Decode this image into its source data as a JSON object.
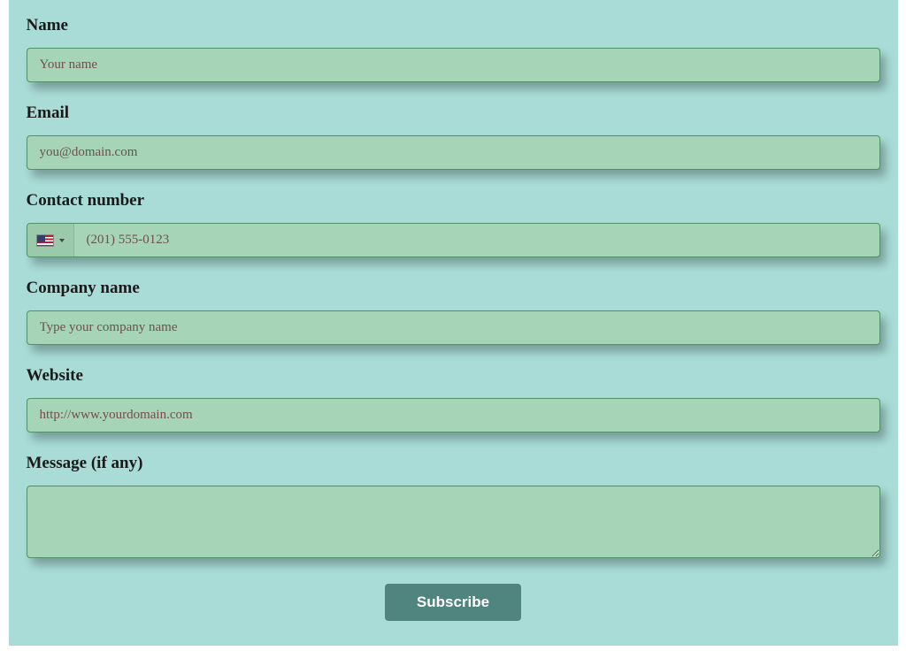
{
  "form": {
    "name": {
      "label": "Name",
      "placeholder": "Your name",
      "value": ""
    },
    "email": {
      "label": "Email",
      "placeholder": "you@domain.com",
      "value": ""
    },
    "phone": {
      "label": "Contact number",
      "placeholder": "(201) 555-0123",
      "value": "",
      "country_icon": "flag-usa"
    },
    "company": {
      "label": "Company name",
      "placeholder": "Type your company name",
      "value": ""
    },
    "website": {
      "label": "Website",
      "placeholder": "http://www.yourdomain.com",
      "value": ""
    },
    "message": {
      "label": "Message (if any)",
      "placeholder": "",
      "value": ""
    },
    "submit_label": "Subscribe"
  },
  "colors": {
    "page_bg": "#a9dcd7",
    "input_bg": "#a5d5b6",
    "input_border": "#4f9169",
    "button_bg": "#50857f",
    "button_text": "#ffffff"
  }
}
